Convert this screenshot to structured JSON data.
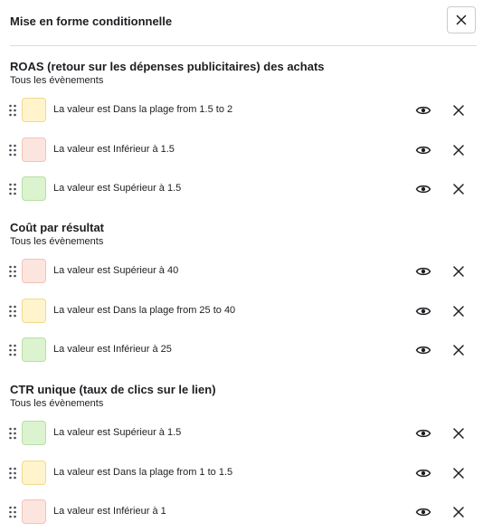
{
  "title": "Mise en forme conditionnelle",
  "icons": {
    "close": "close-icon",
    "drag": "drag-handle-icon",
    "visibility": "eye-icon",
    "remove": "close-icon"
  },
  "colors": {
    "yellow": {
      "fill": "#fff4cc",
      "border": "#f3d98a"
    },
    "red": {
      "fill": "#fde5df",
      "border": "#f3c2b6"
    },
    "green": {
      "fill": "#dcf3cf",
      "border": "#b6dfa2"
    }
  },
  "sections": [
    {
      "title": "ROAS (retour sur les dépenses publicitaires) des achats",
      "subtitle": "Tous les évènements",
      "rules": [
        {
          "color": "yellow",
          "label": "La valeur est Dans la plage from 1.5 to 2"
        },
        {
          "color": "red",
          "label": "La valeur est Inférieur à 1.5"
        },
        {
          "color": "green",
          "label": "La valeur est Supérieur à 1.5"
        }
      ]
    },
    {
      "title": "Coût par résultat",
      "subtitle": "Tous les évènements",
      "rules": [
        {
          "color": "red",
          "label": "La valeur est Supérieur à 40"
        },
        {
          "color": "yellow",
          "label": "La valeur est Dans la plage from 25 to 40"
        },
        {
          "color": "green",
          "label": "La valeur est Inférieur à 25"
        }
      ]
    },
    {
      "title": "CTR unique (taux de clics sur le lien)",
      "subtitle": "Tous les évènements",
      "rules": [
        {
          "color": "green",
          "label": "La valeur est Supérieur à 1.5"
        },
        {
          "color": "yellow",
          "label": "La valeur est Dans la plage from 1 to 1.5"
        },
        {
          "color": "red",
          "label": "La valeur est Inférieur à 1"
        }
      ]
    }
  ]
}
